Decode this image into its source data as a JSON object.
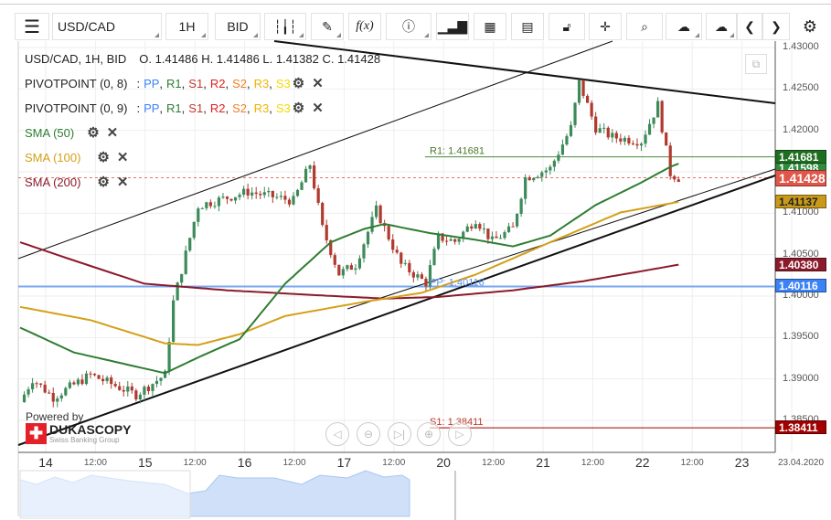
{
  "toolbar": {
    "menu_icon": "hamburger-icon",
    "symbol": "USD/CAD",
    "timeframe": "1H",
    "side": "BID"
  },
  "legend": {
    "ohlc_title": "USD/CAD, 1H, BID",
    "ohlc_values": "O. 1.41486 H. 1.41486 L. 1.41382 C. 1.41428",
    "indicators": [
      {
        "name": "PIVOTPOINT (0, 8)",
        "type": "pivot"
      },
      {
        "name": "PIVOTPOINT (0, 9)",
        "type": "pivot"
      },
      {
        "name": "SMA (50)",
        "color": "#2e7d32"
      },
      {
        "name": "SMA (100)",
        "color": "#d4a017"
      },
      {
        "name": "SMA (200)",
        "color": "#8b1a2b"
      }
    ],
    "pivot_sep": ":",
    "pivot_parts": [
      {
        "t": "PP",
        "c": "#3b82f6"
      },
      {
        "t": "R1",
        "c": "#2e7d32"
      },
      {
        "t": "S1",
        "c": "#c0392b"
      },
      {
        "t": "R2",
        "c": "#e02020"
      },
      {
        "t": "S2",
        "c": "#f0802a"
      },
      {
        "t": "R3",
        "c": "#f0b400"
      },
      {
        "t": "S3",
        "c": "#f5d800"
      }
    ]
  },
  "levels": {
    "r1_label": "R1: 1.41681",
    "pp_label": "PP: 1.40116",
    "s1_label": "S1: 1.38411"
  },
  "badges": [
    {
      "v": "1.41681",
      "c": "#1f6e1f",
      "price": 1.41681
    },
    {
      "v": "1.41598",
      "c": "#2e8b3e",
      "price": 1.41598
    },
    {
      "v": "1.41428",
      "c": "#e0574a",
      "price": 1.41428
    },
    {
      "v": "1.41137",
      "c": "#c99a1a",
      "price": 1.41137
    },
    {
      "v": "1.40380",
      "c": "#8b1a2b",
      "price": 1.4038
    },
    {
      "v": "1.40116",
      "c": "#3b82f6",
      "price": 1.40116
    },
    {
      "v": "1.38411",
      "c": "#a00000",
      "price": 1.38411
    }
  ],
  "branding": {
    "powered": "Powered by",
    "logo": "DUKASCOPY",
    "tagline": "Swiss Banking Group"
  },
  "chart_data": {
    "type": "candlestick",
    "y_ticks": [
      "1.43000",
      "1.42500",
      "1.42000",
      "1.41500",
      "1.41000",
      "1.40500",
      "1.40000",
      "1.39500",
      "1.39000",
      "1.38500"
    ],
    "ylim": [
      1.3805,
      1.4305
    ],
    "x_ticks": [
      {
        "t": "14",
        "day": true
      },
      {
        "t": "12:00"
      },
      {
        "t": "15",
        "day": true
      },
      {
        "t": "12:00"
      },
      {
        "t": "16",
        "day": true
      },
      {
        "t": "12:00"
      },
      {
        "t": "17",
        "day": true
      },
      {
        "t": "12:00"
      },
      {
        "t": "20",
        "day": true
      },
      {
        "t": "12:00"
      },
      {
        "t": "21",
        "day": true
      },
      {
        "t": "12:00"
      },
      {
        "t": "22",
        "day": true
      },
      {
        "t": "12:00"
      },
      {
        "t": "23",
        "day": true
      },
      {
        "t": "23.04.2020"
      }
    ],
    "price_path": [
      [
        0,
        1.3872
      ],
      [
        3,
        1.39
      ],
      [
        8,
        1.3878
      ],
      [
        17,
        1.3905
      ],
      [
        28,
        1.3881
      ],
      [
        35,
        1.3905
      ],
      [
        37,
        1.3993
      ],
      [
        43,
        1.4109
      ],
      [
        55,
        1.4126
      ],
      [
        66,
        1.4115
      ],
      [
        70,
        1.4159
      ],
      [
        73,
        1.4082
      ],
      [
        77,
        1.4027
      ],
      [
        81,
        1.4038
      ],
      [
        86,
        1.4104
      ],
      [
        92,
        1.4038
      ],
      [
        98,
        1.4016
      ],
      [
        101,
        1.4071
      ],
      [
        105,
        1.4066
      ],
      [
        110,
        1.4093
      ],
      [
        114,
        1.4066
      ],
      [
        119,
        1.4082
      ],
      [
        122,
        1.4143
      ],
      [
        128,
        1.4154
      ],
      [
        133,
        1.4203
      ],
      [
        135,
        1.4258
      ],
      [
        139,
        1.4203
      ],
      [
        143,
        1.4192
      ],
      [
        150,
        1.4187
      ],
      [
        154,
        1.4231
      ],
      [
        157,
        1.4148
      ],
      [
        159,
        1.41428
      ]
    ],
    "sma50": [
      [
        0,
        1.3962
      ],
      [
        13,
        1.3932
      ],
      [
        35,
        1.3907
      ],
      [
        43,
        1.3926
      ],
      [
        53,
        1.3948
      ],
      [
        64,
        1.4015
      ],
      [
        75,
        1.4065
      ],
      [
        83,
        1.4081
      ],
      [
        88,
        1.4087
      ],
      [
        99,
        1.4076
      ],
      [
        110,
        1.4068
      ],
      [
        119,
        1.406
      ],
      [
        128,
        1.4073
      ],
      [
        139,
        1.411
      ],
      [
        150,
        1.4137
      ],
      [
        157,
        1.4156
      ],
      [
        159,
        1.41598
      ]
    ],
    "sma100": [
      [
        0,
        1.3987
      ],
      [
        17,
        1.3971
      ],
      [
        35,
        1.3943
      ],
      [
        43,
        1.3941
      ],
      [
        53,
        1.3954
      ],
      [
        64,
        1.3976
      ],
      [
        83,
        1.3993
      ],
      [
        97,
        1.4004
      ],
      [
        110,
        1.4026
      ],
      [
        128,
        1.4065
      ],
      [
        145,
        1.4101
      ],
      [
        159,
        1.41137
      ]
    ],
    "sma200": [
      [
        0,
        1.4065
      ],
      [
        13,
        1.4043
      ],
      [
        30,
        1.4015
      ],
      [
        50,
        1.4007
      ],
      [
        72,
        1.4001
      ],
      [
        88,
        1.3997
      ],
      [
        101,
        1.3999
      ],
      [
        119,
        1.4007
      ],
      [
        136,
        1.4018
      ],
      [
        150,
        1.403
      ],
      [
        159,
        1.4038
      ]
    ]
  }
}
